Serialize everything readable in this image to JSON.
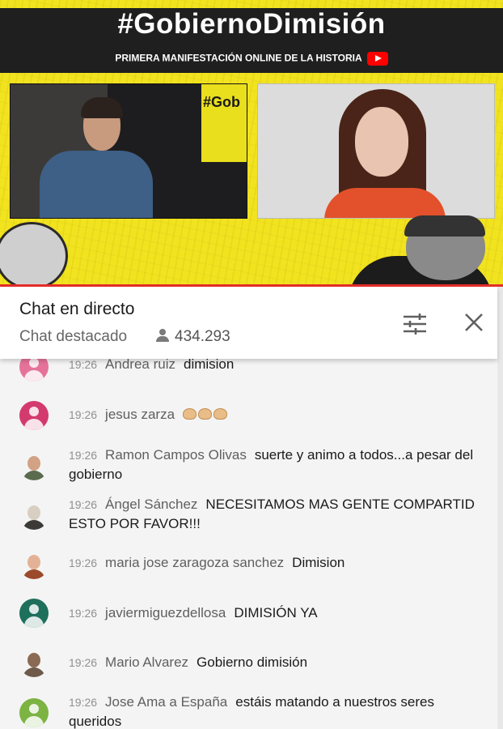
{
  "video": {
    "hashtag": "#GobiernoDimisión",
    "subtitle": "PRIMERA MANIFESTACIÓN ONLINE DE LA HISTORIA",
    "screen_text": "#Gob",
    "youtube_icon": "youtube-play-icon"
  },
  "header": {
    "title": "Chat en directo",
    "subtitle": "Chat destacado",
    "viewers": "434.293",
    "viewers_icon": "person-icon",
    "filter_icon": "tune-icon",
    "close_icon": "close-icon"
  },
  "colors": {
    "accent_red": "#e52d27",
    "banner_yellow": "#f2e31f",
    "author_gray": "#5f5f5f"
  },
  "messages": [
    {
      "time": "19:26",
      "author": "Andrea ruiz",
      "text": "dimision",
      "avatar_color": "#e57399"
    },
    {
      "time": "19:26",
      "author": "jesus zarza",
      "text": "",
      "emoji": [
        "clapping-hands-icon",
        "clapping-hands-icon",
        "clapping-hands-icon"
      ],
      "avatar_color": "#d33a6e"
    },
    {
      "time": "19:26",
      "author": "Ramon Campos Olivas",
      "text": "suerte y animo a todos...a pesar del gobierno",
      "avatar_color": "#5a6b4e"
    },
    {
      "time": "19:26",
      "author": "Ángel Sánchez",
      "text": "NECESITAMOS MAS GENTE COMPARTID ESTO POR FAVOR!!!",
      "avatar_color": "#8c8c84"
    },
    {
      "time": "19:26",
      "author": "maria jose zaragoza sanchez",
      "text": "Dimision",
      "avatar_color": "#9c4a2c"
    },
    {
      "time": "19:26",
      "author": "javiermiguezdellosa",
      "text": "DIMISIÓN YA",
      "avatar_color": "#1e6f5c"
    },
    {
      "time": "19:26",
      "author": "Mario Alvarez",
      "text": "Gobierno dimisión",
      "avatar_color": "#6e5a4a"
    },
    {
      "time": "19:26",
      "author": "Jose Ama a España",
      "text": "estáis matando a nuestros seres queridos",
      "avatar_color": "#7cb342"
    }
  ]
}
